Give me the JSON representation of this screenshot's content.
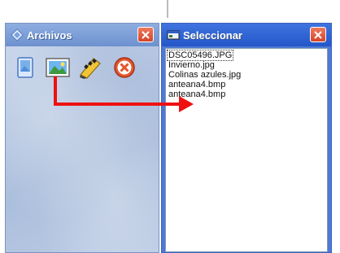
{
  "archivos_window": {
    "title": "Archivos",
    "close_icon": "close-x-icon",
    "toolbar": [
      {
        "name": "document-icon"
      },
      {
        "name": "image-icon"
      },
      {
        "name": "film-clapper-icon"
      },
      {
        "name": "cancel-icon"
      }
    ]
  },
  "seleccionar_window": {
    "title": "Seleccionar",
    "close_icon": "close-x-icon",
    "files": [
      "DSC05496.JPG",
      "Invierno.jpg",
      "Colinas azules.jpg",
      "anteana4.bmp",
      "anteana4.bmp"
    ],
    "selected_index": 0
  },
  "colors": {
    "arrow": "#ee1111",
    "archivos_title": "#6d91cf",
    "seleccionar_title": "#2456c8"
  }
}
